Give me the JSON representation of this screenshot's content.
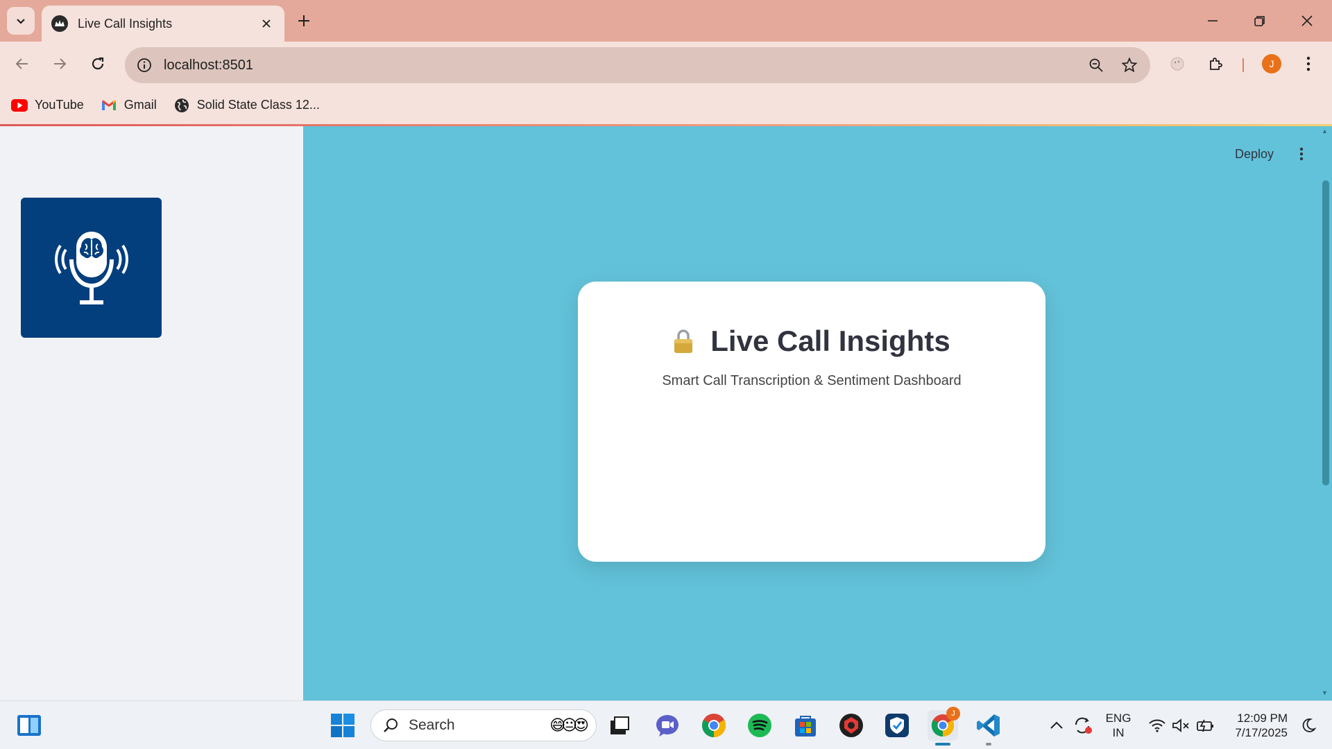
{
  "browser": {
    "tab": {
      "title": "Live Call Insights"
    },
    "url": "localhost:8501",
    "profile_initial": "J",
    "bookmarks": [
      {
        "label": "YouTube",
        "icon": "youtube-icon"
      },
      {
        "label": "Gmail",
        "icon": "gmail-icon"
      },
      {
        "label": "Solid State Class 12...",
        "icon": "globe-icon"
      }
    ]
  },
  "app": {
    "deploy_label": "Deploy",
    "card": {
      "title": "Live Call Insights",
      "subtitle": "Smart Call Transcription & Sentiment Dashboard",
      "title_icon": "lock-icon"
    },
    "logo_icon": "brain-microphone-icon"
  },
  "taskbar": {
    "search_label": "Search",
    "language": {
      "line1": "ENG",
      "line2": "IN"
    },
    "clock": {
      "time": "12:09 PM",
      "date": "7/17/2025"
    },
    "chrome_badge": "J"
  },
  "colors": {
    "tabstrip": "#e4a99a",
    "page_background": "#62c2d9",
    "sidebar": "#f0f2f6",
    "logo_background": "#033e7d",
    "avatar": "#e8711a"
  }
}
